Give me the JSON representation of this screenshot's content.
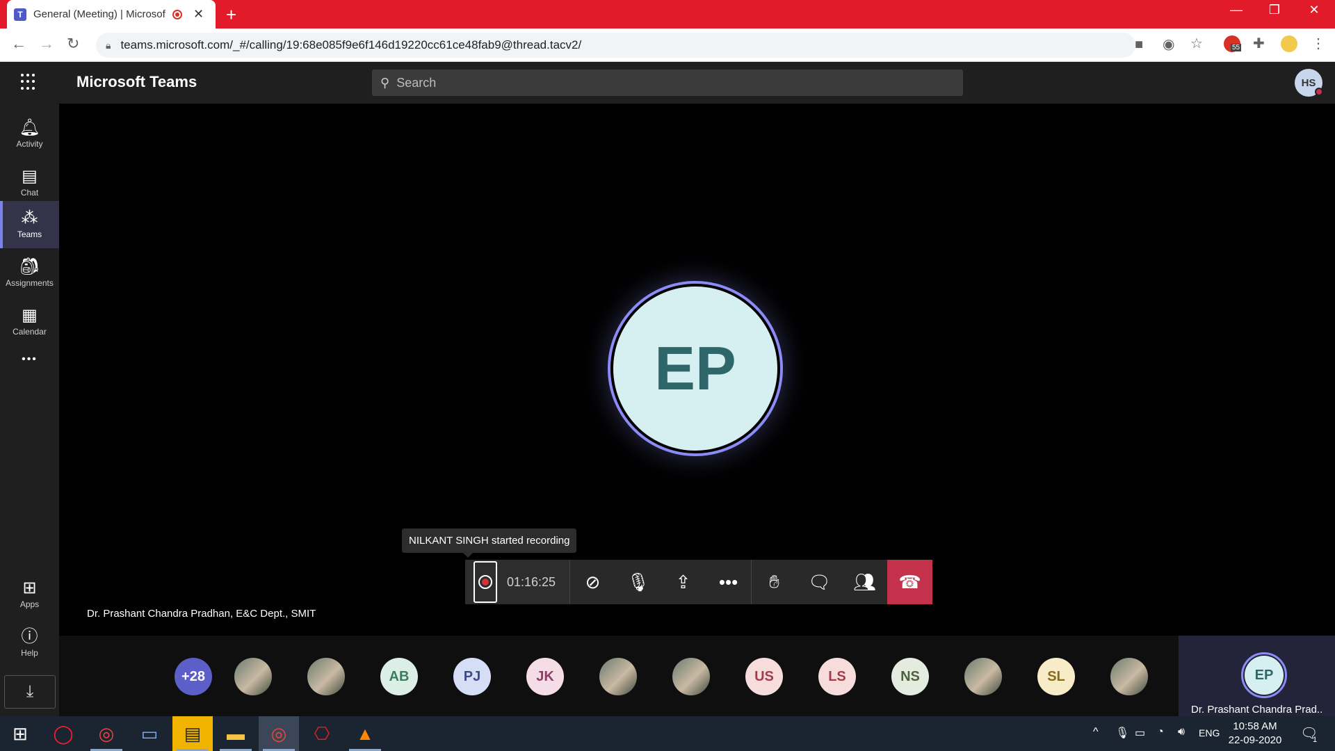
{
  "browser": {
    "tab_title": "General (Meeting) | Microsoft Teams",
    "url": "teams.microsoft.com/_#/calling/19:68e085f9e6f146d19220cc61ce48fab9@thread.tacv2/",
    "ext_badge": "55"
  },
  "teams": {
    "app_title": "Microsoft Teams",
    "search_placeholder": "Search",
    "user_initials": "HS",
    "rail": [
      {
        "label": "Activity",
        "icon": "bell-icon"
      },
      {
        "label": "Chat",
        "icon": "chat-icon"
      },
      {
        "label": "Teams",
        "icon": "teams-icon"
      },
      {
        "label": "Assignments",
        "icon": "assignments-icon"
      },
      {
        "label": "Calendar",
        "icon": "calendar-icon"
      },
      {
        "label": "Apps",
        "icon": "apps-icon"
      },
      {
        "label": "Help",
        "icon": "help-icon"
      }
    ],
    "more_label": "•••"
  },
  "meeting": {
    "main_initials": "EP",
    "speaker_name": "Dr. Prashant Chandra Pradhan, E&C Dept., SMIT",
    "toast": "NILKANT SINGH started recording",
    "timer": "01:16:25",
    "overflow_count": "+28",
    "participants": [
      {
        "initials": "",
        "photo": true
      },
      {
        "initials": "",
        "photo": true
      },
      {
        "initials": "AB",
        "bg": "#dbefe6",
        "fg": "#3d7a63"
      },
      {
        "initials": "PJ",
        "bg": "#d6def5",
        "fg": "#3b4c8a"
      },
      {
        "initials": "JK",
        "bg": "#f5dde7",
        "fg": "#8a4064"
      },
      {
        "initials": "",
        "photo": true
      },
      {
        "initials": "",
        "photo": true
      },
      {
        "initials": "US",
        "bg": "#f7dcdc",
        "fg": "#a23d4c"
      },
      {
        "initials": "LS",
        "bg": "#f7dcdc",
        "fg": "#a23d4c"
      },
      {
        "initials": "NS",
        "bg": "#e4ece0",
        "fg": "#4c6140"
      },
      {
        "initials": "",
        "photo": true
      },
      {
        "initials": "SL",
        "bg": "#f8ebc8",
        "fg": "#8a6a1f"
      },
      {
        "initials": "",
        "photo": true
      }
    ],
    "active_name": "Dr. Prashant Chandra Prad...",
    "active_initials": "EP"
  },
  "taskbar": {
    "time": "10:58 AM",
    "date": "22-09-2020",
    "lang": "ENG",
    "notif_count": "1"
  }
}
